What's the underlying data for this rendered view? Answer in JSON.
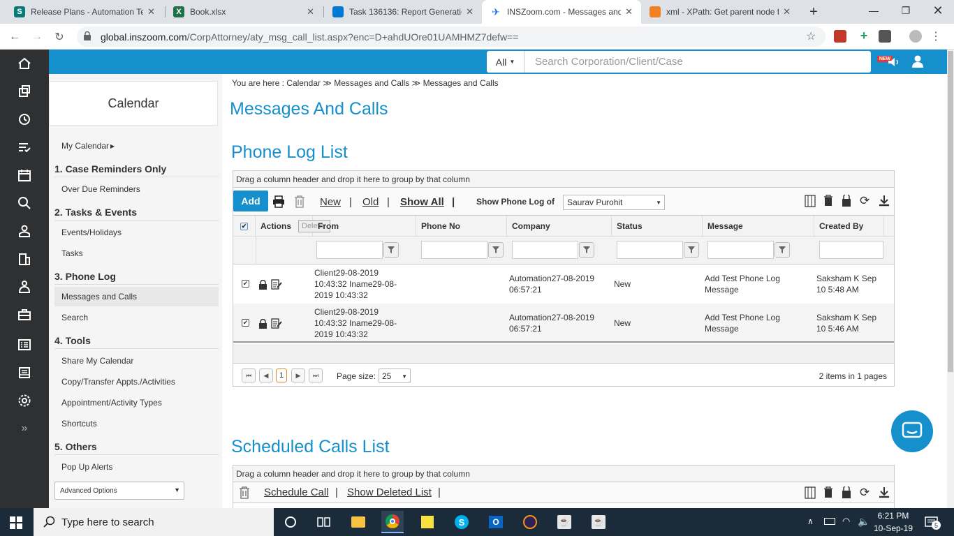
{
  "browser": {
    "tabs": [
      {
        "title": "Release Plans - Automation Te",
        "favicon_color": "#0b7a75"
      },
      {
        "title": "Book.xlsx",
        "favicon_color": "#1e7145"
      },
      {
        "title": "Task 136136: Report Generatio",
        "favicon_color": "#0078d4"
      },
      {
        "title": "INSZoom.com - Messages and",
        "favicon_color": "#1a73e8"
      },
      {
        "title": "xml - XPath: Get parent node f",
        "favicon_color": "#f48024"
      }
    ],
    "new_tab": "+",
    "url_host": "global.inszoom.com",
    "url_path": "/CorpAttorney/aty_msg_call_list.aspx?enc=D+ahdUOre01UAMHMZ7defw=="
  },
  "header": {
    "search_scope": "All",
    "search_placeholder": "Search Corporation/Client/Case",
    "new_badge": "NEW"
  },
  "sidebar": {
    "title": "Calendar",
    "my_calendar": "My Calendar",
    "sections": [
      {
        "title": "1. Case Reminders Only",
        "items": [
          "Over Due Reminders"
        ]
      },
      {
        "title": "2. Tasks & Events",
        "items": [
          "Events/Holidays",
          "Tasks"
        ]
      },
      {
        "title": "3. Phone Log",
        "items": [
          "Messages and Calls",
          "Search"
        ]
      },
      {
        "title": "4. Tools",
        "items": [
          "Share My Calendar",
          "Copy/Transfer Appts./Activities",
          "Appointment/Activity Types",
          "Shortcuts"
        ]
      },
      {
        "title": "5. Others",
        "items": [
          "Pop Up Alerts"
        ]
      }
    ],
    "advanced_options": "Advanced Options"
  },
  "breadcrumb": {
    "prefix": "You are here :",
    "items": [
      "Calendar",
      "Messages and Calls",
      "Messages and Calls"
    ]
  },
  "page_title": "Messages And Calls",
  "phone_log": {
    "title": "Phone Log List",
    "group_hint": "Drag a column header and drop it here to group by that column",
    "add": "Add",
    "filters": [
      "New",
      "Old",
      "Show All"
    ],
    "show_of_label": "Show Phone Log of",
    "show_of_value": "Saurav Purohit",
    "delete_tooltip": "Delete",
    "columns": [
      "Actions",
      "From",
      "Phone No",
      "Company",
      "Status",
      "Message",
      "Created By"
    ],
    "rows": [
      {
        "from": "Client29-08-2019 10:43:32 Iname29-08-2019 10:43:32",
        "phone": "",
        "company": "Automation27-08-2019 06:57:21",
        "status": "New",
        "message": "Add Test Phone Log Message",
        "created_by": "Saksham K Sep 10 5:48 AM"
      },
      {
        "from": "Client29-08-2019 10:43:32 Iname29-08-2019 10:43:32",
        "phone": "",
        "company": "Automation27-08-2019 06:57:21",
        "status": "New",
        "message": "Add Test Phone Log Message",
        "created_by": "Saksham K Sep 10 5:46 AM"
      }
    ],
    "pager": {
      "current_page": "1",
      "page_size_label": "Page size:",
      "page_size": "25",
      "summary": "2 items in 1 pages"
    }
  },
  "scheduled_calls": {
    "title": "Scheduled Calls List",
    "group_hint": "Drag a column header and drop it here to group by that column",
    "links": [
      "Schedule Call",
      "Show Deleted List"
    ]
  },
  "taskbar": {
    "search_placeholder": "Type here to search",
    "time": "6:21 PM",
    "date": "10-Sep-19",
    "notifications": "5"
  }
}
